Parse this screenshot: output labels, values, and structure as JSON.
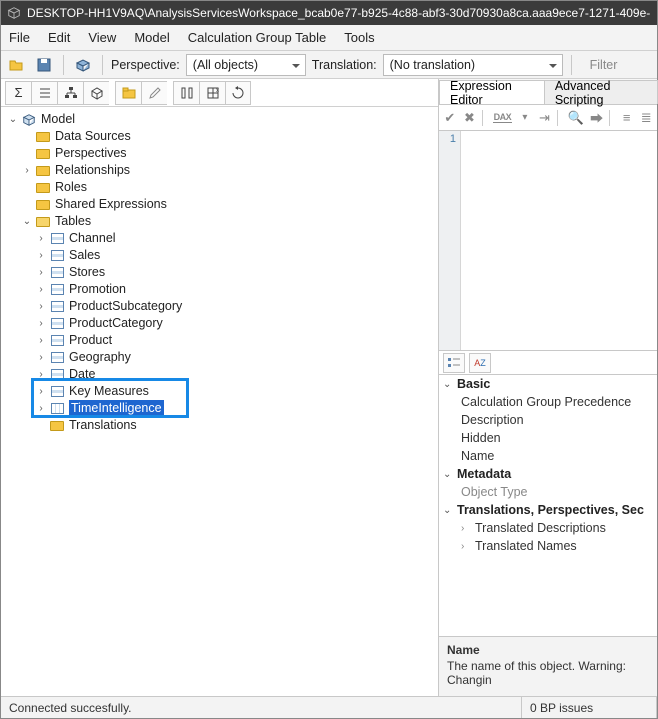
{
  "title": "DESKTOP-HH1V9AQ\\AnalysisServicesWorkspace_bcab0e77-b925-4c88-abf3-30d70930a8ca.aaa9ece7-1271-409e-",
  "menu": {
    "file": "File",
    "edit": "Edit",
    "view": "View",
    "model": "Model",
    "cgt": "Calculation Group Table",
    "tools": "Tools"
  },
  "toolbar": {
    "perspective_label": "Perspective:",
    "perspective_value": "(All objects)",
    "translation_label": "Translation:",
    "translation_value": "(No translation)",
    "filter_placeholder": "Filter"
  },
  "tree": {
    "root": "Model",
    "folders": {
      "datasources": "Data Sources",
      "perspectives": "Perspectives",
      "relationships": "Relationships",
      "roles": "Roles",
      "sharedexpr": "Shared Expressions",
      "tables": "Tables",
      "translations": "Translations"
    },
    "tables": [
      "Channel",
      "Sales",
      "Stores",
      "Promotion",
      "ProductSubcategory",
      "ProductCategory",
      "Product",
      "Geography",
      "Date",
      "Key Measures",
      "TimeIntelligence"
    ]
  },
  "right": {
    "tabs": {
      "expr": "Expression Editor",
      "adv": "Advanced Scripting"
    },
    "gutter_line": "1",
    "props": {
      "basic": "Basic",
      "cgp": "Calculation Group Precedence",
      "desc": "Description",
      "hidden": "Hidden",
      "name": "Name",
      "metadata": "Metadata",
      "objtype": "Object Type",
      "tps": "Translations, Perspectives, Sec",
      "tdesc": "Translated Descriptions",
      "tnames": "Translated Names"
    },
    "descpane": {
      "title": "Name",
      "text": "The name of this object. Warning: Changin"
    }
  },
  "status": {
    "left": "Connected succesfully.",
    "right": "0 BP issues"
  }
}
